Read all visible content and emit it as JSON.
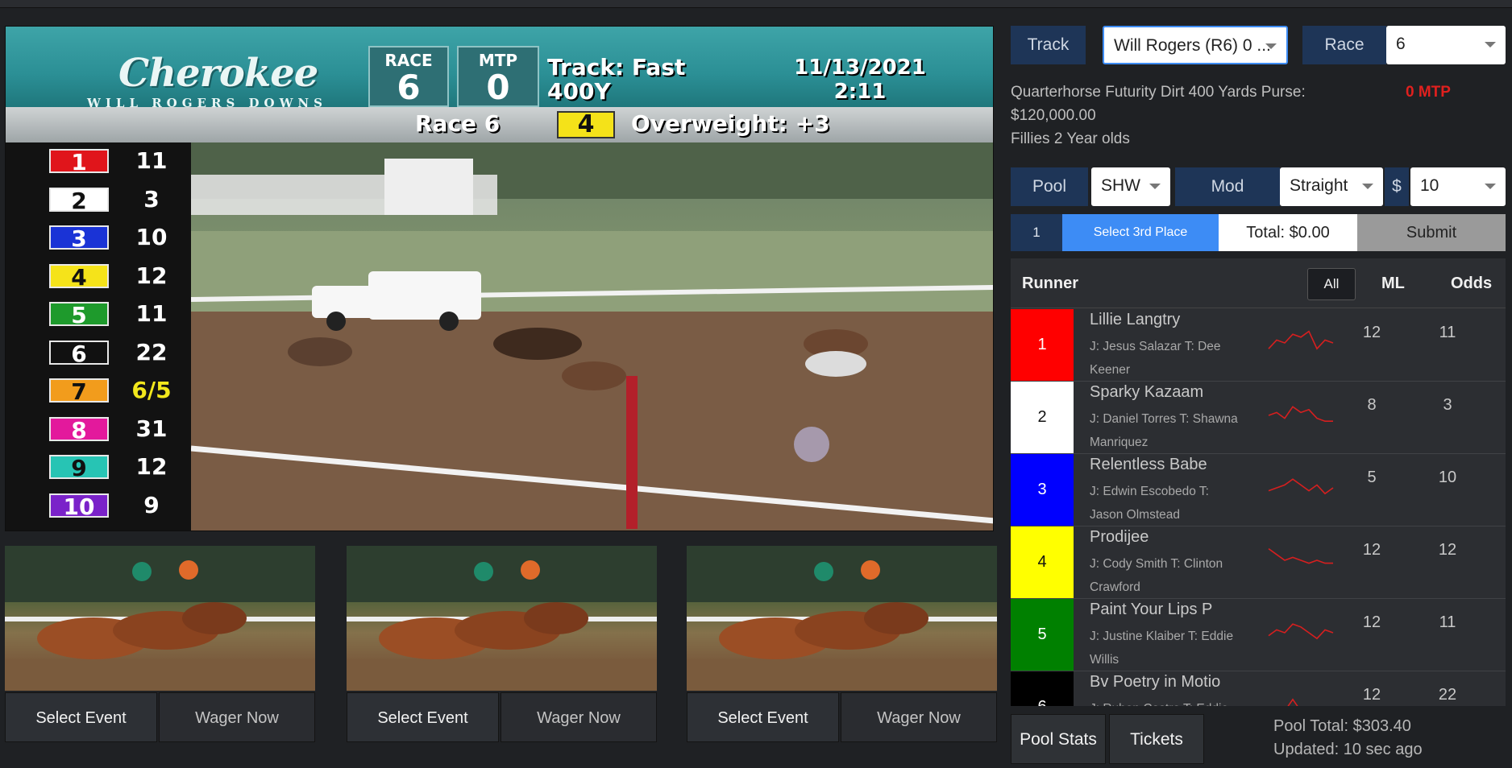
{
  "video": {
    "logo_script": "Cherokee",
    "logo_sub": "WILL ROGERS DOWNS",
    "race_label": "RACE",
    "race_number": "6",
    "mtp_label": "MTP",
    "mtp_value": "0",
    "track_condition": "Track: Fast",
    "distance": "400Y",
    "date": "11/13/2021",
    "time": "2:11",
    "race_banner": "Race 6",
    "overweight_pp": "4",
    "overweight_text": "Overweight: +3",
    "odds_board": [
      {
        "pp": "1",
        "odds": "11",
        "bg": "#e0151b",
        "fg": "#ffffff"
      },
      {
        "pp": "2",
        "odds": "3",
        "bg": "#ffffff",
        "fg": "#111111"
      },
      {
        "pp": "3",
        "odds": "10",
        "bg": "#1a33d6",
        "fg": "#ffffff"
      },
      {
        "pp": "4",
        "odds": "12",
        "bg": "#f5e31a",
        "fg": "#111111"
      },
      {
        "pp": "5",
        "odds": "11",
        "bg": "#1e9a2c",
        "fg": "#ffffff"
      },
      {
        "pp": "6",
        "odds": "22",
        "bg": "#111111",
        "fg": "#ffffff"
      },
      {
        "pp": "7",
        "odds": "6/5",
        "bg": "#f29c1c",
        "fg": "#111111",
        "highlight": "#f2e71c"
      },
      {
        "pp": "8",
        "odds": "31",
        "bg": "#e3199c",
        "fg": "#ffffff"
      },
      {
        "pp": "9",
        "odds": "12",
        "bg": "#27c4b4",
        "fg": "#111111"
      },
      {
        "pp": "10",
        "odds": "9",
        "bg": "#7a22c9",
        "fg": "#ffffff"
      }
    ]
  },
  "events": [
    {
      "select_label": "Select Event",
      "wager_label": "Wager Now"
    },
    {
      "select_label": "Select Event",
      "wager_label": "Wager Now"
    },
    {
      "select_label": "Select Event",
      "wager_label": "Wager Now"
    }
  ],
  "panel": {
    "track_label": "Track",
    "track_value": "Will Rogers (R6) 0 ...",
    "race_label": "Race",
    "race_value": "6",
    "info_line1": "Quarterhorse  Futurity Dirt 400 Yards  Purse:",
    "info_line2": "$120,000.00",
    "info_line3": "Fillies 2 Year olds",
    "mtp": "0 MTP",
    "pool_label": "Pool",
    "pool_value": "SHW",
    "mod_label": "Mod",
    "mod_value": "Straight",
    "amount_label": "$",
    "amount_value": "10",
    "bet_index": "1",
    "select_place": "Select 3rd Place",
    "total": "Total: $0.00",
    "submit": "Submit"
  },
  "runners_table": {
    "col_runner": "Runner",
    "all_button": "All",
    "col_ml": "ML",
    "col_odds": "Odds",
    "rows": [
      {
        "pp": "1",
        "bg": "#ff0000",
        "fg": "#ffffff",
        "name": "Lillie Langtry",
        "jt_line1": "J: Jesus Salazar T: Dee",
        "jt_line2": "Keener",
        "ml": "12",
        "odds": "11",
        "spark": [
          14,
          8,
          10,
          4,
          6,
          2,
          14,
          8,
          10
        ]
      },
      {
        "pp": "2",
        "bg": "#ffffff",
        "fg": "#111111",
        "name": "Sparky Kazaam",
        "jt_line1": "J: Daniel Torres T: Shawna",
        "jt_line2": "Manriquez",
        "ml": "8",
        "odds": "3",
        "spark": [
          10,
          8,
          12,
          4,
          8,
          6,
          12,
          14,
          14
        ]
      },
      {
        "pp": "3",
        "bg": "#0000ff",
        "fg": "#ffffff",
        "name": "Relentless Babe",
        "jt_line1": "J: Edwin Escobedo T:",
        "jt_line2": "Jason Olmstead",
        "ml": "5",
        "odds": "10",
        "spark": [
          12,
          10,
          8,
          4,
          8,
          12,
          8,
          14,
          10
        ]
      },
      {
        "pp": "4",
        "bg": "#ffff00",
        "fg": "#111111",
        "name": "Prodijee",
        "jt_line1": "J: Cody Smith T: Clinton",
        "jt_line2": "Crawford",
        "ml": "12",
        "odds": "12",
        "spark": [
          2,
          6,
          10,
          8,
          10,
          12,
          10,
          12,
          12
        ]
      },
      {
        "pp": "5",
        "bg": "#008000",
        "fg": "#ffffff",
        "name": "Paint Your Lips P",
        "jt_line1": "J: Justine Klaiber T: Eddie",
        "jt_line2": "Willis",
        "ml": "12",
        "odds": "11",
        "spark": [
          12,
          8,
          10,
          4,
          6,
          10,
          14,
          8,
          10
        ]
      },
      {
        "pp": "6",
        "bg": "#000000",
        "fg": "#ffffff",
        "name": "Bv Poetry in Motio",
        "jt_line1": "J: Ruben Castro T: Eddie",
        "jt_line2": "",
        "ml": "12",
        "odds": "22",
        "spark": [
          14,
          14,
          14,
          6,
          14,
          14,
          14,
          14,
          14
        ]
      }
    ]
  },
  "footer": {
    "pool_stats": "Pool Stats",
    "tickets": "Tickets",
    "pool_total": "Pool Total: $303.40",
    "updated": "Updated: 10 sec ago"
  }
}
